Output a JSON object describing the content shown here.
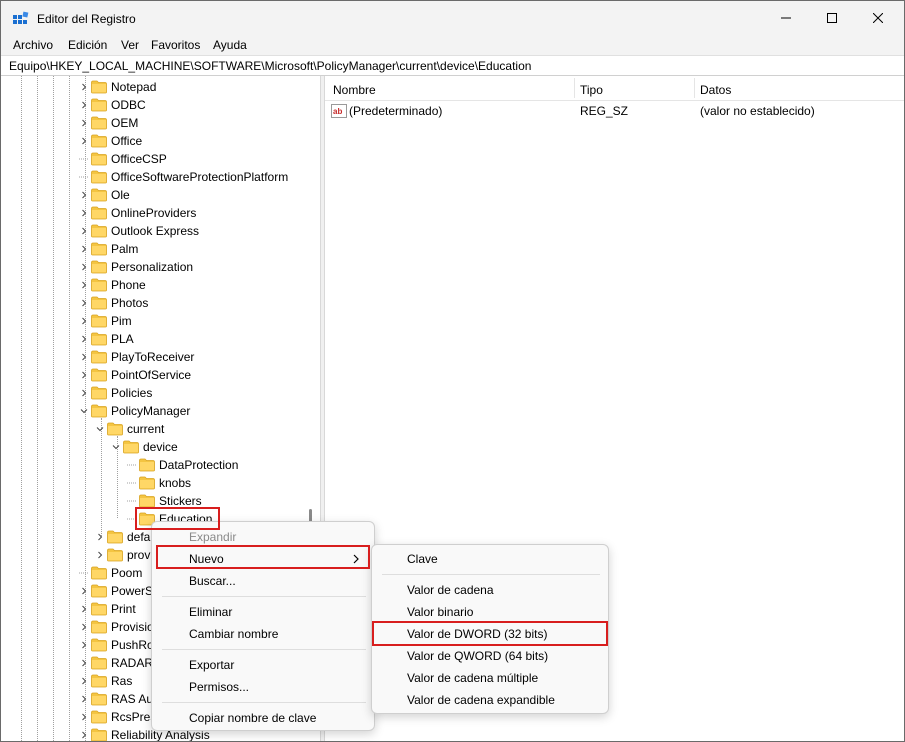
{
  "window": {
    "title": "Editor del Registro",
    "controls": [
      "minimize-icon",
      "maximize-icon",
      "close-icon"
    ]
  },
  "menubar": {
    "items": [
      "Archivo",
      "Edición",
      "Ver",
      "Favoritos",
      "Ayuda"
    ]
  },
  "address": "Equipo\\HKEY_LOCAL_MACHINE\\SOFTWARE\\Microsoft\\PolicyManager\\current\\device\\Education",
  "tree": {
    "items": [
      {
        "label": "Notepad",
        "expandable": true
      },
      {
        "label": "ODBC",
        "expandable": true
      },
      {
        "label": "OEM",
        "expandable": true
      },
      {
        "label": "Office",
        "expandable": true
      },
      {
        "label": "OfficeCSP",
        "expandable": false
      },
      {
        "label": "OfficeSoftwareProtectionPlatform",
        "expandable": false
      },
      {
        "label": "Ole",
        "expandable": true
      },
      {
        "label": "OnlineProviders",
        "expandable": true
      },
      {
        "label": "Outlook Express",
        "expandable": true
      },
      {
        "label": "Palm",
        "expandable": true
      },
      {
        "label": "Personalization",
        "expandable": true
      },
      {
        "label": "Phone",
        "expandable": true
      },
      {
        "label": "Photos",
        "expandable": true
      },
      {
        "label": "Pim",
        "expandable": true
      },
      {
        "label": "PLA",
        "expandable": true
      },
      {
        "label": "PlayToReceiver",
        "expandable": true
      },
      {
        "label": "PointOfService",
        "expandable": true
      },
      {
        "label": "Policies",
        "expandable": true
      },
      {
        "label": "PolicyManager",
        "expandable": true,
        "expanded": true
      },
      {
        "label": "current",
        "expandable": true,
        "expanded": true
      },
      {
        "label": "device",
        "expandable": true,
        "expanded": true
      },
      {
        "label": "DataProtection",
        "expandable": false
      },
      {
        "label": "knobs",
        "expandable": false
      },
      {
        "label": "Stickers",
        "expandable": false
      },
      {
        "label": "Education",
        "expandable": false,
        "selected": true
      },
      {
        "label": "defa",
        "expandable": true
      },
      {
        "label": "prov",
        "expandable": true
      },
      {
        "label": "Poom",
        "expandable": false
      },
      {
        "label": "PowerS",
        "expandable": true
      },
      {
        "label": "Print",
        "expandable": true
      },
      {
        "label": "Provisio",
        "expandable": true
      },
      {
        "label": "PushRo",
        "expandable": true
      },
      {
        "label": "RADAR",
        "expandable": true
      },
      {
        "label": "Ras",
        "expandable": true
      },
      {
        "label": "RAS Au",
        "expandable": true
      },
      {
        "label": "RcsPres",
        "expandable": true
      },
      {
        "label": "Reliability Analysis",
        "expandable": true
      }
    ]
  },
  "list": {
    "columns": [
      "Nombre",
      "Tipo",
      "Datos"
    ],
    "rows": [
      {
        "name": "(Predeterminado)",
        "type": "REG_SZ",
        "data": "(valor no establecido)",
        "icon": "string-value-icon"
      }
    ]
  },
  "context_menu": {
    "items": [
      {
        "label": "Expandir",
        "disabled": true
      },
      {
        "label": "Nuevo",
        "submenu": true,
        "highlighted": true
      },
      {
        "label": "Buscar..."
      },
      {
        "label": "Eliminar"
      },
      {
        "label": "Cambiar nombre"
      },
      {
        "label": "Exportar"
      },
      {
        "label": "Permisos..."
      },
      {
        "label": "Copiar nombre de clave"
      }
    ]
  },
  "submenu": {
    "items": [
      {
        "label": "Clave"
      },
      {
        "label": "Valor de cadena"
      },
      {
        "label": "Valor binario"
      },
      {
        "label": "Valor de DWORD (32 bits)",
        "highlighted": true
      },
      {
        "label": "Valor de QWORD (64 bits)"
      },
      {
        "label": "Valor de cadena múltiple"
      },
      {
        "label": "Valor de cadena expandible"
      }
    ]
  },
  "colors": {
    "highlight_border": "#d81e1e",
    "folder": "#f4c542",
    "app_icon": "#1a6fd1"
  }
}
